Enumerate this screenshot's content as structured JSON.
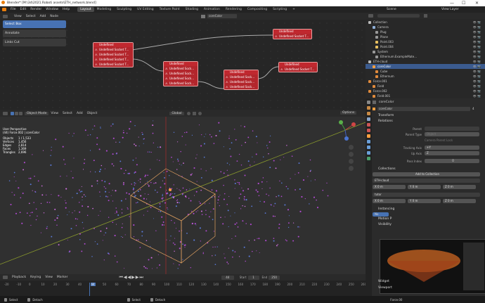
{
  "window": {
    "title": "Blender* [M:\\3d\\2021.Roboti assets\\ETH_network.blend]",
    "controls": [
      "—",
      "☐",
      "✕"
    ]
  },
  "menu": [
    "File",
    "Edit",
    "Render",
    "Window",
    "Help"
  ],
  "workspaces": [
    "Layout",
    "Modeling",
    "Sculpting",
    "UV Editing",
    "Texture Paint",
    "Shading",
    "Animation",
    "Rendering",
    "Compositing",
    "Scripting"
  ],
  "active_workspace": "Layout",
  "scene": {
    "label": "Scene",
    "view_layer": "View Layer"
  },
  "node_editor": {
    "header_menus": [
      "View",
      "Select",
      "Add",
      "Node"
    ],
    "node_tree_name": "coreColor",
    "tools": [
      "Select Box",
      "Annotate",
      "Links Cut"
    ],
    "nodes": [
      {
        "title": "Undefined",
        "sockets": [
          "Undefined Socket T...",
          "Undefined Socket T...",
          "Undefined Socket T...",
          "Undefined Socket T..."
        ]
      },
      {
        "title": "Undefined",
        "sockets": [
          "Undefined Sock...",
          "Undefined Sock...",
          "Undefined Sock...",
          "Undefined Sock..."
        ]
      },
      {
        "title": "Undefined",
        "sockets": [
          "Undefined Sock...",
          "Undefined Sock...",
          "Undefined Sock..."
        ]
      },
      {
        "title": "Undefined",
        "sockets": [
          "Undefined Socket T..."
        ]
      },
      {
        "title": "Undefined",
        "sockets": [
          "Undefined Socket T..."
        ]
      }
    ]
  },
  "viewport": {
    "mode": "Object Mode",
    "header_menus": [
      "View",
      "Select",
      "Add",
      "Object"
    ],
    "orientation": "Global",
    "options_label": "Options",
    "view_name": "User Perspective",
    "object_label": "(44) Force.002 | coreColor",
    "stats": [
      {
        "k": "Objects",
        "v": "1 / 1,533"
      },
      {
        "k": "Vertices",
        "v": "1,456"
      },
      {
        "k": "Edges",
        "v": "2,814"
      },
      {
        "k": "Faces",
        "v": "1,369"
      },
      {
        "k": "Triangles",
        "v": "2,696"
      }
    ]
  },
  "timeline": {
    "menus": [
      "Playback",
      "Keying",
      "View",
      "Marker"
    ],
    "current_frame": "44",
    "start_label": "Start",
    "start": "1",
    "end_label": "End",
    "end": "250",
    "ticks": [
      "-20",
      "-10",
      "0",
      "10",
      "20",
      "30",
      "40",
      "44",
      "50",
      "60",
      "70",
      "80",
      "90",
      "100",
      "110",
      "120",
      "130",
      "140",
      "150",
      "160",
      "170",
      "180",
      "190",
      "200",
      "210",
      "220",
      "230",
      "240",
      "250",
      "260"
    ]
  },
  "statusbar": [
    "Select",
    "Detach",
    "Select",
    "Detach",
    "Force.00"
  ],
  "outliner": {
    "rows": [
      {
        "name": "Collection",
        "icon_color": "#bbbbbb",
        "selected": false
      },
      {
        "name": "Camera",
        "icon_color": "#8fb0d8",
        "selected": false
      },
      {
        "name": "Plug",
        "icon_color": "#999999",
        "selected": false
      },
      {
        "name": "Plane",
        "icon_color": "#999999",
        "selected": false
      },
      {
        "name": "Point.003",
        "icon_color": "#e8c060",
        "selected": false
      },
      {
        "name": "Point.004",
        "icon_color": "#e8c060",
        "selected": false
      },
      {
        "name": "System",
        "icon_color": "#999999",
        "selected": false
      },
      {
        "name": "Ethernum.ExampleMate...",
        "icon_color": "#999999",
        "selected": false
      },
      {
        "name": "ETH-cloud",
        "icon_color": "#bbbbbb",
        "selected": false
      },
      {
        "name": "coreColor",
        "icon_color": "#ffa040",
        "selected": true
      },
      {
        "name": "Cube",
        "icon_color": "#e08a3c",
        "selected": false
      },
      {
        "name": "Ethernum",
        "icon_color": "#e08a3c",
        "selected": false
      },
      {
        "name": "Force.001",
        "icon_color": "#e08a3c",
        "selected": false
      },
      {
        "name": "Field",
        "icon_color": "#e08a3c",
        "selected": false
      },
      {
        "name": "Force.002",
        "icon_color": "#e08a3c",
        "selected": false
      },
      {
        "name": "Field.001",
        "icon_color": "#e08a3c",
        "selected": false
      },
      {
        "name": "Circle.003",
        "icon_color": "#e08a3c",
        "selected": false
      }
    ]
  },
  "properties": {
    "object_name": "coreColor",
    "data_name": "coreColor",
    "sections": {
      "transform": "Transform",
      "relations": "Relations",
      "collections": "Collections",
      "instancing": "Instancing",
      "motion_paths": "Motion P",
      "visibility": "Visibility",
      "viewport": "Viewport",
      "widgets": "Widget"
    },
    "parent_label": "Parent",
    "parent_type_label": "Parent Type",
    "parent_type": "Object",
    "camera_parent_lock": "Camera Parent Lock",
    "tracking_axis_label": "Tracking Axis",
    "tracking_axis": "+Y",
    "up_axis_label": "Up Axis",
    "up_axis": "Z",
    "pass_index_label": "Pass Index",
    "pass_index": "0",
    "add_to_collection": "Add to Collection",
    "collection1": "ETH-cloud",
    "collection2": "tutor",
    "offset_labels": [
      "X",
      "Y",
      "Z"
    ],
    "offset_values": [
      "0 m",
      "0 m",
      "0 m"
    ],
    "users_count": "4",
    "instancing_value": "No"
  },
  "colors": {
    "accent": "#4772b3",
    "node_error": "#b3262c",
    "playhead": "#4772b3",
    "selection": "#ffa040"
  }
}
